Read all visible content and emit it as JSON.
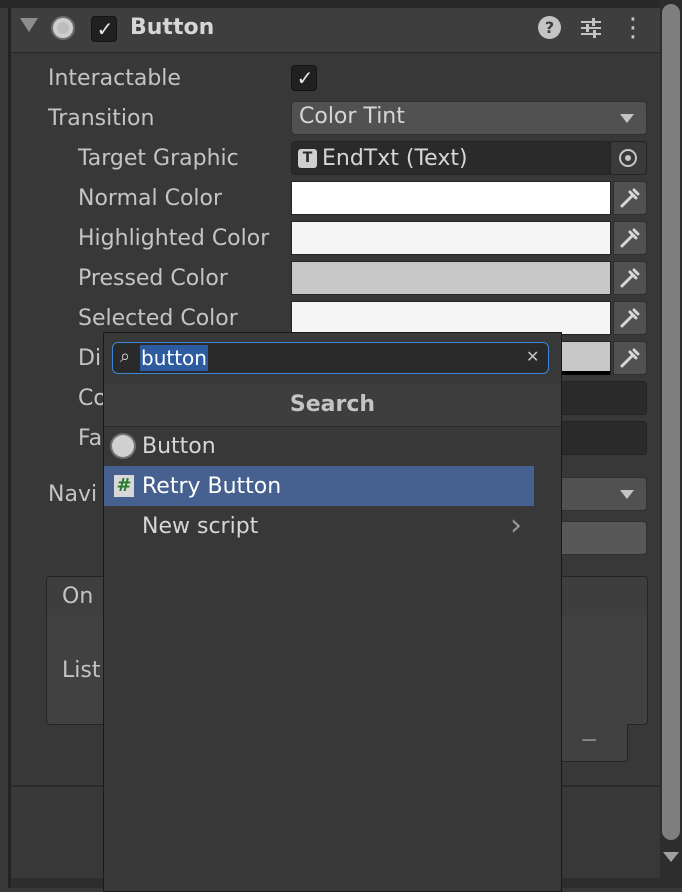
{
  "component": {
    "title": "Button",
    "enabled": true
  },
  "props": {
    "interactable_label": "Interactable",
    "interactable_value": true,
    "transition_label": "Transition",
    "transition_value": "Color Tint",
    "target_graphic_label": "Target Graphic",
    "target_graphic_value": "EndTxt (Text)",
    "normal_color_label": "Normal Color",
    "highlighted_color_label": "Highlighted Color",
    "pressed_color_label": "Pressed Color",
    "selected_color_label": "Selected Color",
    "disabled_color_label_visible": "Di",
    "color_multiplier_label_visible": "Co",
    "fade_duration_label_visible": "Fa",
    "navigation_label_visible": "Navi",
    "onclick_label_visible": "On",
    "list_label_visible": "List",
    "minus_symbol": "−"
  },
  "colors": {
    "normal": "#ffffff",
    "highlighted": "#f5f5f5",
    "pressed": "#c8c8c8",
    "selected": "#f5f5f5",
    "disabled": "#c8c8c8"
  },
  "popup": {
    "search_value": "button",
    "header": "Search",
    "items": [
      {
        "label": "Button",
        "icon": "component-circle-icon"
      },
      {
        "label": "Retry Button",
        "icon": "script-hash-icon",
        "selected": true
      },
      {
        "label": "New script",
        "icon": "",
        "submenu": true
      }
    ]
  },
  "icons": {
    "check": "✓",
    "clear": "✕",
    "search": "⌕",
    "chevron": "›",
    "hash": "#",
    "target_letter": "T",
    "help": "?",
    "kebab": "⋮"
  }
}
